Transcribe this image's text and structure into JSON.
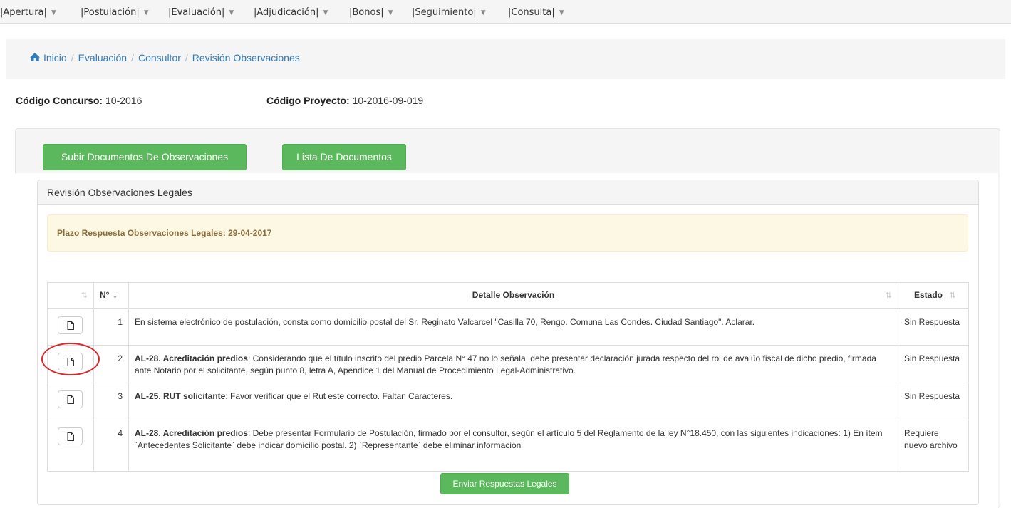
{
  "menu": [
    {
      "label": "|Apertura|"
    },
    {
      "label": "|Postulación|"
    },
    {
      "label": "|Evaluación|"
    },
    {
      "label": "|Adjudicación|"
    },
    {
      "label": "|Bonos|"
    },
    {
      "label": "|Seguimiento|"
    },
    {
      "label": "|Consulta|"
    }
  ],
  "breadcrumb": {
    "home": "Inicio",
    "items": [
      "Evaluación",
      "Consultor",
      "Revisión Observaciones"
    ]
  },
  "codes": {
    "concurso_label": "Código Concurso:",
    "concurso_value": "10-2016",
    "proyecto_label": "Código Proyecto:",
    "proyecto_value": "10-2016-09-019"
  },
  "buttons": {
    "subir": "Subir Documentos De Observaciones",
    "lista": "Lista De Documentos",
    "enviar": "Enviar Respuestas Legales"
  },
  "panel": {
    "title": "Revisión Observaciones Legales",
    "alert": "Plazo Respuesta Observaciones Legales: 29-04-2017"
  },
  "table": {
    "headers": {
      "num": "N°",
      "detalle": "Detalle Observación",
      "estado": "Estado"
    },
    "rows": [
      {
        "num": "1",
        "bold": "",
        "text": "En sistema electrónico de postulación, consta como domicilio postal del Sr. Reginato Valcarcel \"Casilla 70, Rengo. Comuna Las Condes. Ciudad Santiago\". Aclarar.",
        "estado": "Sin Respuesta"
      },
      {
        "num": "2",
        "bold": "AL-28. Acreditación predios",
        "text": ": Considerando que el título inscrito del predio Parcela N° 47 no lo señala, debe presentar declaración jurada respecto del rol de avalúo fiscal de dicho predio, firmada ante Notario por el solicitante, según punto 8, letra A, Apéndice 1 del Manual de Procedimiento Legal-Administrativo.",
        "estado": "Sin Respuesta"
      },
      {
        "num": "3",
        "bold": "AL-25. RUT solicitante",
        "text": ": Favor verificar que el Rut este correcto. Faltan Caracteres.",
        "estado": "Sin Respuesta"
      },
      {
        "num": "4",
        "bold": "AL-28. Acreditación predios",
        "text": ": Debe presentar Formulario de Postulación, firmado por el consultor, según el artículo 5 del Reglamento de la ley N°18.450, con las siguientes indicaciones: 1) En ítem `Antecedentes Solicitante` debe indicar domicilio postal. 2) `Representante` debe eliminar información",
        "estado": "Requiere nuevo archivo"
      }
    ]
  },
  "colors": {
    "link": "#337ab7",
    "success": "#5cb85c",
    "warning_text": "#8a6d3b",
    "annotation": "#d9292e"
  },
  "icons": [
    "home-icon",
    "file-icon",
    "sort-icon",
    "sort-asc-icon",
    "caret-down-icon"
  ]
}
